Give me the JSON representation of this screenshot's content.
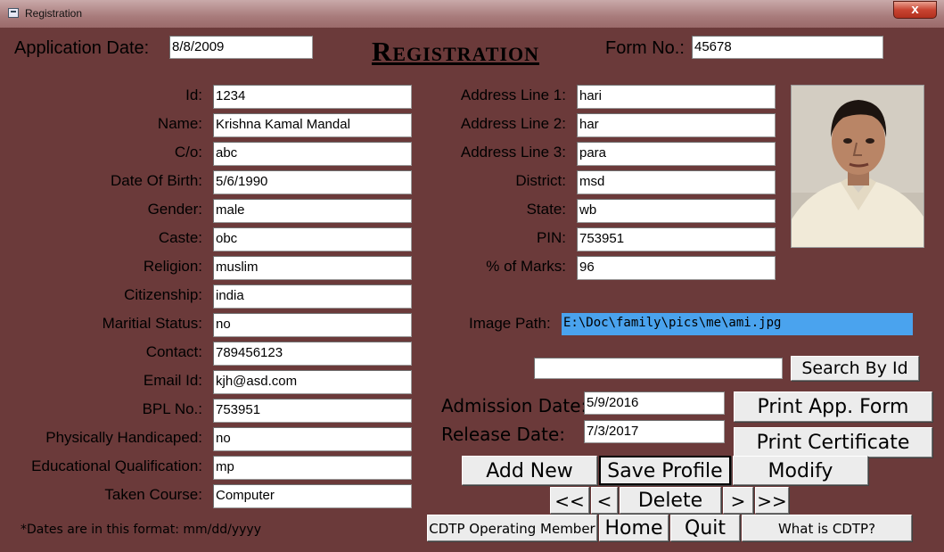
{
  "window": {
    "title": "Registration",
    "close_glyph": "x"
  },
  "heading": "Registration",
  "header": {
    "application_date_label": "Application Date:",
    "application_date_value": "8/8/2009",
    "form_no_label": "Form No.:",
    "form_no_value": "45678"
  },
  "left_fields": [
    {
      "label": "Id:",
      "value": "1234"
    },
    {
      "label": "Name:",
      "value": "Krishna Kamal Mandal"
    },
    {
      "label": "C/o:",
      "value": "abc"
    },
    {
      "label": "Date Of Birth:",
      "value": "5/6/1990"
    },
    {
      "label": "Gender:",
      "value": "male"
    },
    {
      "label": "Caste:",
      "value": "obc"
    },
    {
      "label": "Religion:",
      "value": "muslim"
    },
    {
      "label": "Citizenship:",
      "value": "india"
    },
    {
      "label": "Maritial Status:",
      "value": "no"
    },
    {
      "label": "Contact:",
      "value": "789456123"
    },
    {
      "label": "Email Id:",
      "value": "kjh@asd.com"
    },
    {
      "label": "BPL No.:",
      "value": "753951"
    },
    {
      "label": "Physically Handicaped:",
      "value": "no"
    },
    {
      "label": "Educational Qualification:",
      "value": "mp"
    },
    {
      "label": "Taken Course:",
      "value": "Computer"
    }
  ],
  "right_fields": [
    {
      "label": "Address Line 1:",
      "value": "hari"
    },
    {
      "label": "Address Line 2:",
      "value": "har"
    },
    {
      "label": "Address Line 3:",
      "value": "para"
    },
    {
      "label": "District:",
      "value": "msd"
    },
    {
      "label": "State:",
      "value": "wb"
    },
    {
      "label": "PIN:",
      "value": "753951"
    },
    {
      "label": "% of Marks:",
      "value": "96"
    }
  ],
  "image_path": {
    "label": "Image Path:",
    "value": "E:\\Doc\\family\\pics\\me\\ami.jpg"
  },
  "search": {
    "value": "",
    "button": "Search By Id"
  },
  "dates": {
    "admission_label": "Admission Date:",
    "admission_value": "5/9/2016",
    "release_label": "Release Date:",
    "release_value": "7/3/2017"
  },
  "buttons": {
    "print_app_form": "Print App. Form",
    "print_certificate": "Print Certificate",
    "add_new": "Add New",
    "save_profile": "Save Profile",
    "modify": "Modify",
    "first": "<<",
    "prev": "<",
    "delete": "Delete",
    "next": ">",
    "last": ">>",
    "cdtp_member": "CDTP Operating Member",
    "home": "Home",
    "quit": "Quit",
    "what_is_cdtp": "What is CDTP?"
  },
  "footnote": "*Dates are in this format: mm/dd/yyyy"
}
